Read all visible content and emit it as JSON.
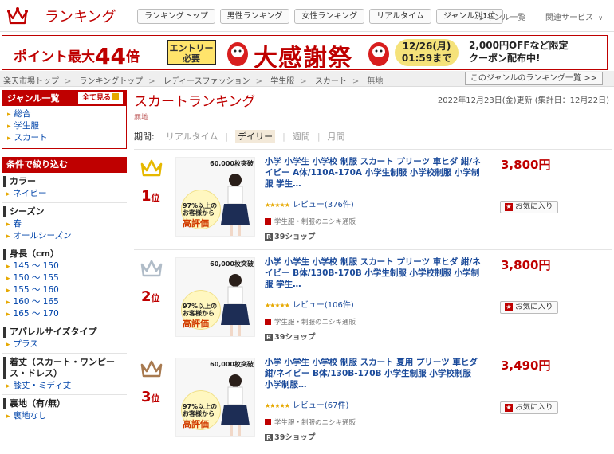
{
  "header": {
    "logo_text": "ランキング",
    "nav": [
      "ランキングトップ",
      "男性ランキング",
      "女性ランキング",
      "リアルタイム",
      "ジャンル別1位"
    ],
    "genre_list_link": "ジャンル一覧",
    "related_services": "関連サービス",
    "chevron": "chevron-down-icon"
  },
  "banner": {
    "point_text": "ポイント最大",
    "point_big": "44",
    "point_unit": "倍",
    "entry_line1": "エントリー",
    "entry_line2": "必要",
    "title": "大感謝祭",
    "date_line1": "12/26(月)",
    "date_line2": "01:59まで",
    "right_line1": "2,000円OFFなど限定",
    "right_line2": "クーポン配布中!",
    "colors": {
      "brand": "#bf0000",
      "entry_bg": "#ffe46b",
      "date_bg": "#f5e27a"
    }
  },
  "breadcrumb": {
    "items": [
      "楽天市場トップ",
      "ランキングトップ",
      "レディースファッション",
      "学生服",
      "スカート",
      "無地"
    ],
    "separator": ">",
    "genre_ranking_list": "このジャンルのランキング一覧 >>"
  },
  "sidebar": {
    "genre_head": "ジャンル一覧",
    "show_all": "全て見る",
    "genres": [
      "総合",
      "学生服",
      "スカート"
    ],
    "filter_head": "条件で絞り込む",
    "filters": [
      {
        "title": "カラー",
        "items": [
          "ネイビー"
        ]
      },
      {
        "title": "シーズン",
        "items": [
          "春",
          "オールシーズン"
        ]
      },
      {
        "title": "身長（cm）",
        "items": [
          "145 ～ 150",
          "150 ～ 155",
          "155 ～ 160",
          "160 ～ 165",
          "165 ～ 170"
        ]
      },
      {
        "title": "アパレルサイズタイプ",
        "items": [
          "プラス"
        ]
      },
      {
        "title": "着丈（スカート・ワンピース・ドレス）",
        "items": [
          "膝丈・ミディ丈"
        ]
      },
      {
        "title": "裏地（有/無）",
        "items": [
          "裏地なし"
        ]
      }
    ]
  },
  "main": {
    "title": "スカートランキング",
    "sub_label": "無地",
    "updated": "2022年12月23日(金)更新 (集計日：12月22日)",
    "period_label": "期間:",
    "periods": [
      "リアルタイム",
      "デイリー",
      "週間",
      "月間"
    ],
    "active_period": "デイリー"
  },
  "items": [
    {
      "rank": "1",
      "rank_suffix": "位",
      "crown_color": "#e6b800",
      "thumb_top": "60,000枚突破",
      "thumb_t1": "97%以上の お客様から",
      "thumb_t2": "高評価",
      "title": "小学 小学生 小学校 制服 スカート プリーツ 車ヒダ 紺/ネイビー A体/110A-170A 小学生制服 小学校制服 小学制服 学生…",
      "price": "3,800円",
      "stars": "★★★★★",
      "review": "レビュー(376件)",
      "fav": "お気に入り",
      "shop_sub": "学生服・制服のニシキ通販",
      "shop": "39ショップ"
    },
    {
      "rank": "2",
      "rank_suffix": "位",
      "crown_color": "#b0bcc8",
      "thumb_top": "60,000枚突破",
      "thumb_t1": "97%以上の お客様から",
      "thumb_t2": "高評価",
      "title": "小学 小学生 小学校 制服 スカート プリーツ 車ヒダ 紺/ネイビー B体/130B-170B 小学生制服 小学校制服 小学制服 学生…",
      "price": "3,800円",
      "stars": "★★★★★",
      "review": "レビュー(106件)",
      "fav": "お気に入り",
      "shop_sub": "学生服・制服のニシキ通販",
      "shop": "39ショップ"
    },
    {
      "rank": "3",
      "rank_suffix": "位",
      "crown_color": "#a87a50",
      "thumb_top": "60,000枚突破",
      "thumb_t1": "97%以上の お客様から",
      "thumb_t2": "高評価",
      "title": "小学 小学生 小学校 制服 スカート 夏用 プリーツ 車ヒダ 紺/ネイビー B体/130B-170B 小学生制服 小学校制服 小学制服…",
      "price": "3,490円",
      "stars": "★★★★★",
      "review": "レビュー(67件)",
      "fav": "お気に入り",
      "shop_sub": "学生服・制服のニシキ通販",
      "shop": "39ショップ"
    }
  ]
}
